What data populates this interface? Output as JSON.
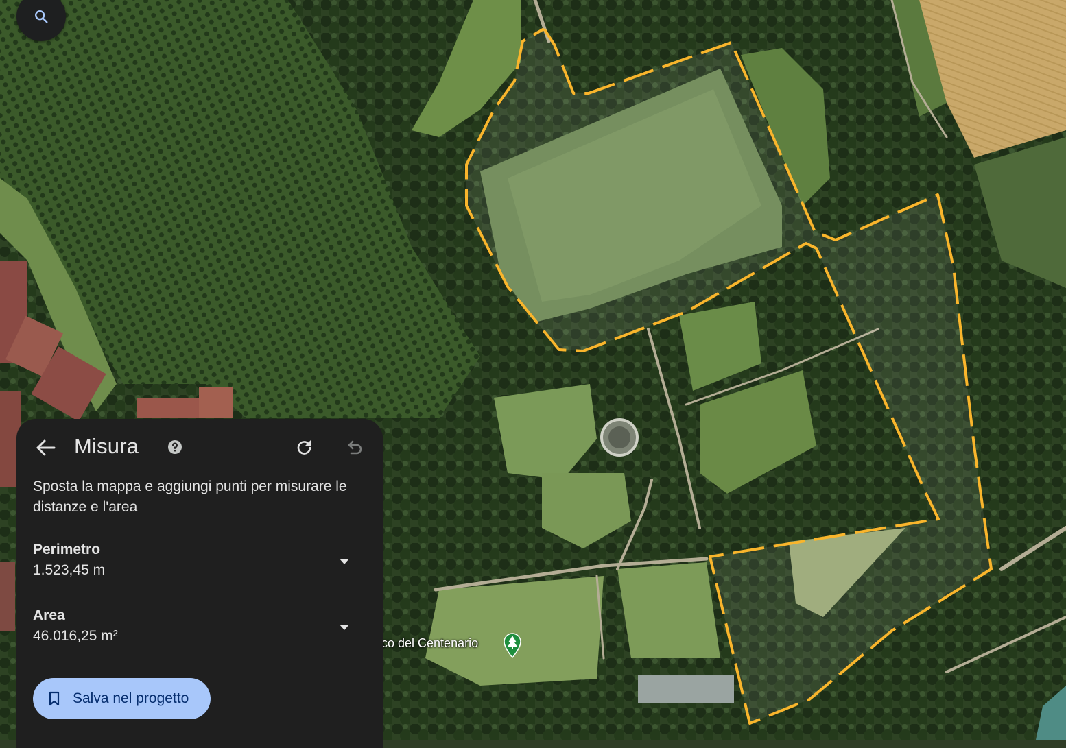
{
  "panel": {
    "title": "Misura",
    "description": "Sposta la mappa e aggiungi punti per misurare le distanze e l'area",
    "metrics": [
      {
        "label": "Perimetro",
        "value": "1.523,45 m"
      },
      {
        "label": "Area",
        "value": "46.016,25 m²"
      }
    ],
    "save_label": "Salva nel progetto"
  },
  "map": {
    "place_label": "co del Centenario",
    "measure_color": "#f9b52c"
  },
  "icons": {
    "search": "search-icon",
    "back": "arrow-back-icon",
    "help": "help-icon",
    "redo": "redo-icon",
    "undo": "undo-icon",
    "dropdown": "chevron-down-icon",
    "bookmark": "bookmark-icon",
    "park": "park-tree-pin-icon"
  }
}
